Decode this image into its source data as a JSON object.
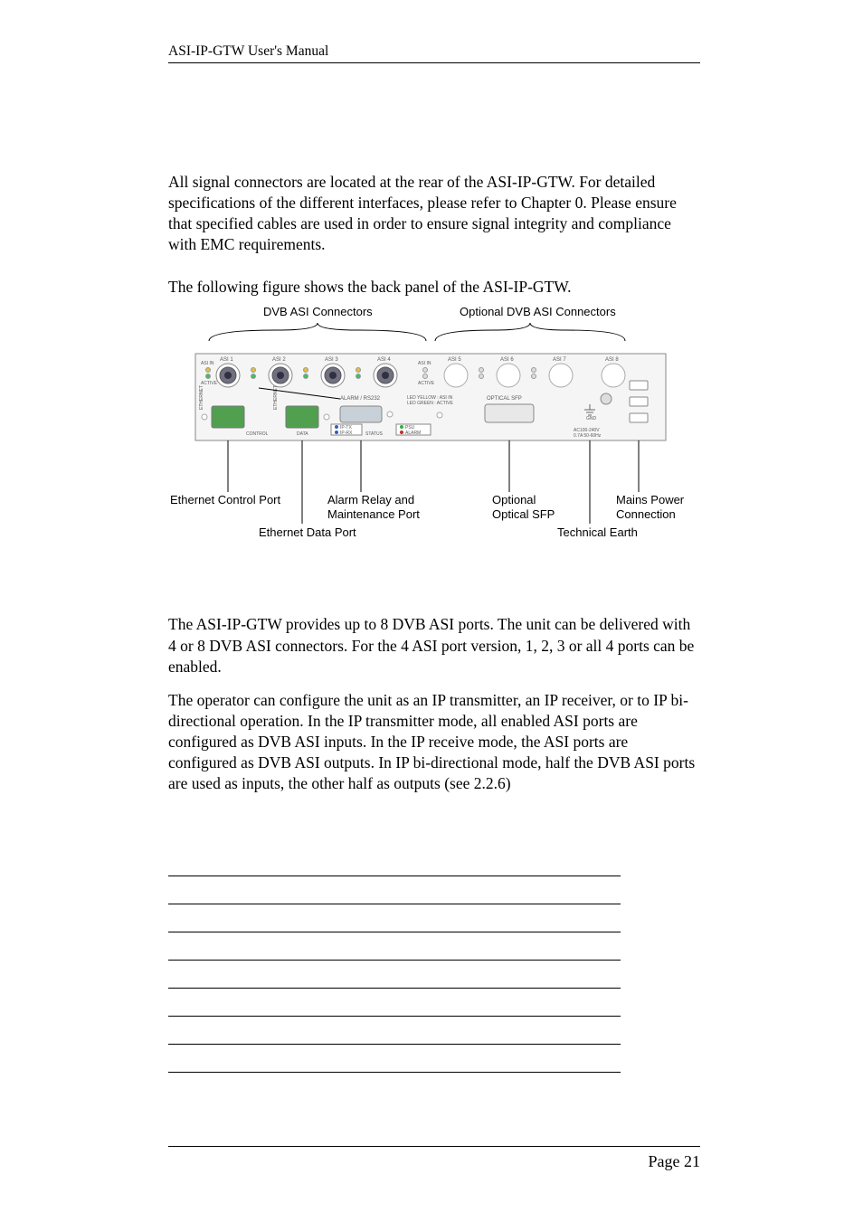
{
  "header": {
    "title": "ASI-IP-GTW User's Manual"
  },
  "intro": {
    "p1": "All signal connectors are located at the rear of the ASI-IP-GTW. For detailed specifications of the different interfaces, please refer to Chapter 0. Please ensure that specified cables are used in order to ensure signal integrity and compliance with EMC requirements.",
    "p2": "The following figure shows the back panel of the ASI-IP-GTW."
  },
  "figure": {
    "top_left": "DVB ASI Connectors",
    "top_right": "Optional DVB ASI Connectors",
    "callouts": {
      "eth_ctrl": "Ethernet Control Port",
      "alarm1": "Alarm Relay and",
      "alarm2": "Maintenance Port",
      "sfp1": "Optional",
      "sfp2": "Optical SFP",
      "mains1": "Mains Power",
      "mains2": "Connection",
      "eth_data": "Ethernet Data Port",
      "t_earth": "Technical Earth"
    },
    "panel": {
      "asi_prefix": "ASI",
      "asi_in": "ASI IN",
      "active": "ACTIVE",
      "alarm_rs232": "ALARM / RS232",
      "led1": "LED YELLOW : ASI IN",
      "led2": "LED GREEN   : ACTIVE",
      "optical_sfp": "OPTICAL SFP",
      "gnd": "GND",
      "ac1": "AC100-240V",
      "ac2": "0.7A 50-60Hz",
      "control": "CONTROL",
      "data": "DATA",
      "status": "STATUS",
      "iptx": "IP-TX",
      "iprx": "IP-RX",
      "psu": "PSU",
      "alarm": "ALARM"
    }
  },
  "after": {
    "p1": "The ASI-IP-GTW provides up to 8 DVB ASI ports. The unit can be delivered with 4 or 8 DVB ASI connectors. For the 4 ASI port version, 1, 2, 3 or all 4 ports can be enabled.",
    "p2": "The operator can configure the unit as an IP transmitter, an IP receiver, or to IP bi-directional operation. In the IP transmitter mode, all enabled ASI ports are configured as DVB ASI inputs. In the IP receive mode, the ASI ports are configured as DVB ASI outputs. In IP bi-directional mode, half the DVB ASI ports are used as inputs, the other half as outputs (see 2.2.6)"
  },
  "footer": {
    "page": "Page 21"
  }
}
